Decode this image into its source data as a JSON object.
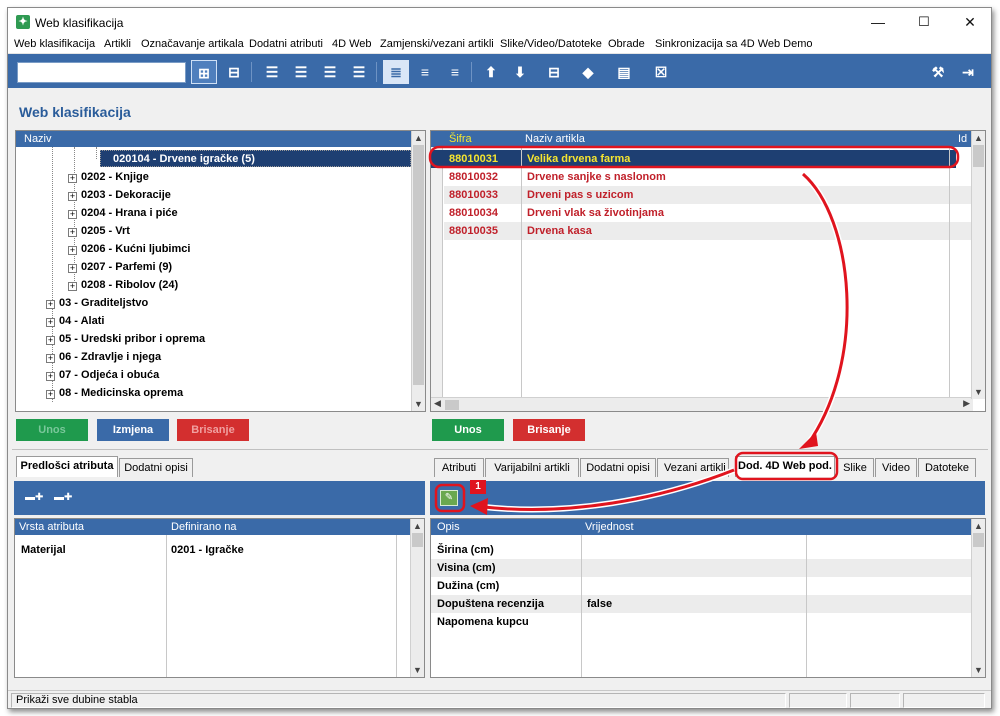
{
  "window": {
    "title": "Web klasifikacija",
    "minimize": "—",
    "maximize": "☐",
    "close": "✕"
  },
  "menu": [
    "Web klasifikacija",
    "Artikli",
    "Označavanje artikala",
    "Dodatni atributi",
    "4D Web",
    "Zamjenski/vezani artikli",
    "Slike/Video/Datoteke",
    "Obrade",
    "Sinkronizacija sa 4D Web Demo"
  ],
  "search": {
    "value": "",
    "placeholder": ""
  },
  "page_title": "Web klasifikacija",
  "tree": {
    "header": "Naziv",
    "selected": "020104 - Drvene igračke (5)",
    "items": [
      "0202 - Knjige",
      "0203 - Dekoracije",
      "0204 - Hrana i piće",
      "0205 - Vrt",
      "0206 - Kućni ljubimci",
      "0207 - Parfemi (9)",
      "0208 - Ribolov (24)"
    ],
    "top_items": [
      "03 - Graditeljstvo",
      "04 - Alati",
      "05 - Uredski pribor i oprema",
      "06 - Zdravlje i njega",
      "07 - Odjeća i obuća",
      "08 - Medicinska oprema"
    ],
    "expand_glyph": "+"
  },
  "articles": {
    "headers": {
      "code": "Šifra",
      "name": "Naziv artikla",
      "extra": "Id"
    },
    "rows": [
      {
        "code": "88010031",
        "name": "Velika drvena farma"
      },
      {
        "code": "88010032",
        "name": "Drvene sanjke s naslonom"
      },
      {
        "code": "88010033",
        "name": "Drveni pas s uzicom"
      },
      {
        "code": "88010034",
        "name": "Drveni vlak sa životinjama"
      },
      {
        "code": "88010035",
        "name": "Drvena kasa"
      }
    ]
  },
  "buttons": {
    "left": {
      "unos": "Unos",
      "izmjena": "Izmjena",
      "brisanje": "Brisanje"
    },
    "right": {
      "unos": "Unos",
      "brisanje": "Brisanje"
    }
  },
  "left_tabs": [
    "Predlošci atributa",
    "Dodatni opisi"
  ],
  "right_tabs": [
    "Atributi",
    "Varijabilni artikli",
    "Dodatni opisi",
    "Vezani artikli",
    "Dod. 4D Web pod.",
    "Slike",
    "Video",
    "Datoteke"
  ],
  "attributes": {
    "headers": {
      "type": "Vrsta atributa",
      "defined": "Definirano na"
    },
    "rows": [
      {
        "type": "Materijal",
        "defined": "0201 - Igračke"
      }
    ]
  },
  "web_data": {
    "headers": {
      "desc": "Opis",
      "value": "Vrijednost"
    },
    "rows": [
      {
        "desc": "Širina (cm)",
        "value": ""
      },
      {
        "desc": "Visina (cm)",
        "value": ""
      },
      {
        "desc": "Dužina (cm)",
        "value": ""
      },
      {
        "desc": "Dopuštena recenzija",
        "value": "false"
      },
      {
        "desc": "Napomena kupcu",
        "value": ""
      }
    ]
  },
  "callout_number": "1",
  "status": "Prikaži sve dubine stabla",
  "colors": {
    "accent": "#3a6aa8",
    "green": "#1f9a4d",
    "red": "#d32f2f",
    "annotation": "#e0141e",
    "highlight_text": "#f5e530"
  }
}
